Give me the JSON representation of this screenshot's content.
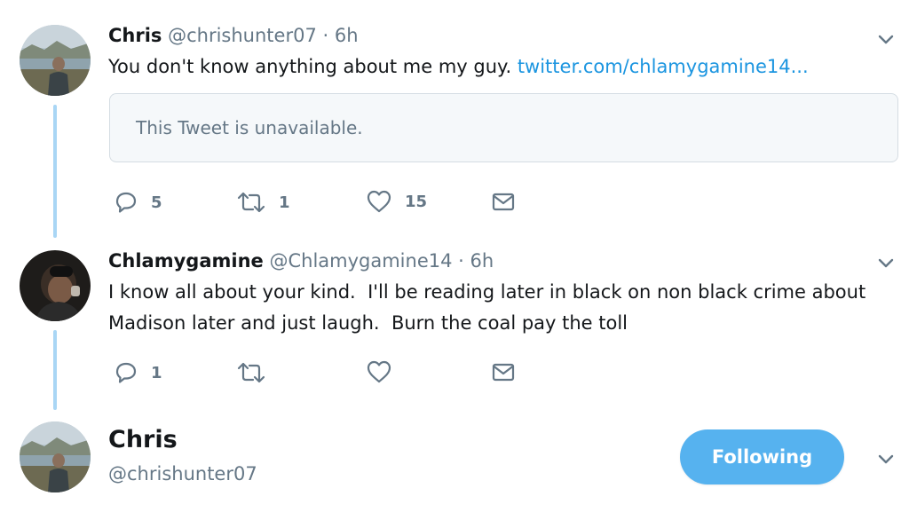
{
  "tweet1": {
    "name": "Chris",
    "handle": "@chrishunter07",
    "time": "· 6h",
    "text_prefix": "You don't know anything about me my guy. ",
    "link": "twitter.com/chlamygamine14...",
    "quote_text": "This Tweet is unavailable.",
    "replies": "5",
    "retweets": "1",
    "likes": "15"
  },
  "tweet2": {
    "name": "Chlamygamine",
    "handle": "@Chlamygamine14",
    "time": "· 6h",
    "line1": "I know all about your kind.  I'll be reading later in black on non black crime about",
    "line2": "Madison later and just laugh.  Burn the coal pay the toll",
    "replies": "1",
    "retweets": "",
    "likes": ""
  },
  "tweet3": {
    "name": "Chris",
    "handle": "@chrishunter07",
    "follow_label": "Following"
  },
  "colors": {
    "link": "#1b95e0",
    "thread_line": "#a9d6f5",
    "following_button": "#56b2ef",
    "icon": "#657786"
  },
  "icons": [
    "reply-icon",
    "retweet-icon",
    "like-icon",
    "dm-icon",
    "chevron-down-icon"
  ]
}
